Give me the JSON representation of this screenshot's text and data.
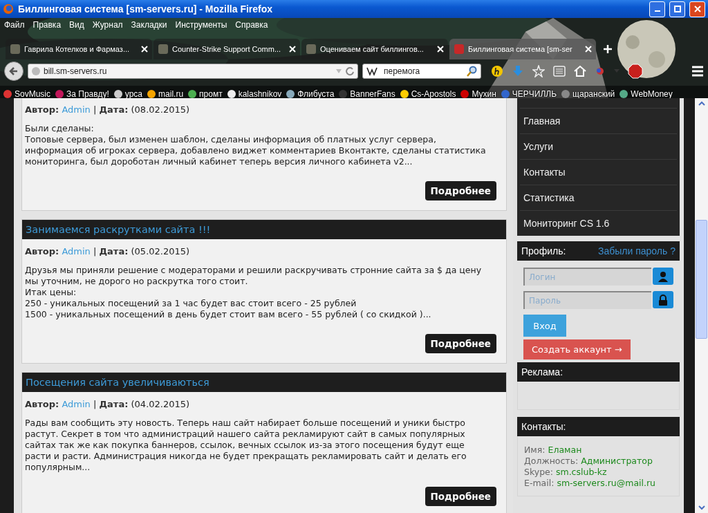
{
  "window": {
    "title": "Биллинговая система [sm-servers.ru] - Mozilla Firefox"
  },
  "menu": [
    "Файл",
    "Правка",
    "Вид",
    "Журнал",
    "Закладки",
    "Инструменты",
    "Справка"
  ],
  "tabs": [
    {
      "label": "Гаврила Котелков и Фармаз...",
      "selected": false
    },
    {
      "label": "Counter-Strike Support Comm...",
      "selected": false
    },
    {
      "label": "Оцениваем сайт биллингов...",
      "selected": false
    },
    {
      "label": "Биллинговая система [sm-ser",
      "selected": true
    }
  ],
  "address_bar": {
    "value": "bill.sm-servers.ru"
  },
  "search_field": {
    "value": "перемога"
  },
  "bookmarks": [
    "SovMusic",
    "За Правду!",
    "урса",
    "mail.ru",
    "промт",
    "kalashnikov",
    "Флибуста",
    "BannerFans",
    "Cs-Apostols",
    "Мухин",
    "ЧЕРЧИЛЛЬ",
    "щаранский",
    "WebMoney"
  ],
  "posts": [
    {
      "author_label": "Автор:",
      "author": "Admin",
      "separator": "|",
      "date_label": "Дата:",
      "date": "(08.02.2015)",
      "body": [
        "Были сделаны:",
        "Топовые сервера, был изменен шаблон, сделаны информация об платных услуг сервера, информация об игроках сервера, добавлено виджет комментариев Вконтакте, сделаны статистика мониторинга, был дороботан личный кабинет теперь версия личного кабинета v2..."
      ],
      "button": "Подробнее"
    },
    {
      "title": "Занимаемся раскрутками сайта !!!",
      "author_label": "Автор:",
      "author": "Admin",
      "separator": "|",
      "date_label": "Дата:",
      "date": "(05.02.2015)",
      "body": [
        "Друзья мы приняли решение с модераторами и решили раскручивать стронние сайта за $ да цену мы уточним, не дорого но раскрутка того стоит.",
        "Итак цены:",
        "250 - уникальных посещений за 1 час будет вас стоит всего - 25 рублей",
        "1500 - уникальных посещений в день будет стоит вам всего - 55 рублей ( со скидкой )..."
      ],
      "button": "Подробнее"
    },
    {
      "title": "Посещения сайта увеличиваються",
      "author_label": "Автор:",
      "author": "Admin",
      "separator": "|",
      "date_label": "Дата:",
      "date": "(04.02.2015)",
      "body": [
        "Рады вам сообщить эту новость. Теперь наш сайт набирает больше посещений и уники быстро растут. Секрет в том что администраций нашего сайта рекламируют сайт в самых популярных сайтах так же как покупка баннеров, ссылок, вечных ссылок из-за этого посещения будут еще расти и расти. Администрация никогда не будет прекращать рекламировать сайт и делать его популярным..."
      ],
      "button": "Подробнее"
    }
  ],
  "sidebar": {
    "menu_items": [
      "Главная",
      "Услуги",
      "Контакты",
      "Статистика",
      "Мониторинг CS 1.6"
    ],
    "profile": {
      "title": "Профиль:",
      "forgot_link": "Забыли пароль ?",
      "login_placeholder": "Логин",
      "password_placeholder": "Пароль",
      "login_button": "Вход",
      "register_button": "Создать аккаунт →"
    },
    "ads": {
      "title": "Реклама:"
    },
    "contacts": {
      "title": "Контакты:",
      "rows": [
        {
          "label": "Имя:",
          "value": "Еламан"
        },
        {
          "label": "Должность:",
          "value": "Администратор"
        },
        {
          "label": "Skype:",
          "value": "sm.cslub-kz"
        },
        {
          "label": "E-mail:",
          "value": "sm-servers.ru@mail.ru"
        }
      ]
    }
  }
}
